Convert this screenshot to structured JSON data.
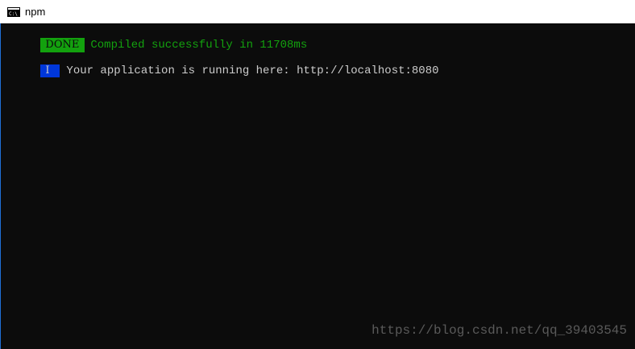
{
  "window": {
    "title": "npm",
    "icon": "console-icon"
  },
  "console": {
    "lines": [
      {
        "badge": "DONE",
        "badge_color": "#13a10e",
        "text": "Compiled successfully in 11708ms",
        "text_color": "#13a10e"
      },
      {
        "badge": "I",
        "badge_color": "#0037da",
        "text": "Your application is running here: http://localhost:8080",
        "text_color": "#cccccc"
      }
    ]
  },
  "watermark": {
    "text": "https://blog.csdn.net/qq_39403545"
  },
  "colors": {
    "background": "#0c0c0c",
    "titlebar": "#ffffff",
    "accent": "#1f6fd6"
  }
}
